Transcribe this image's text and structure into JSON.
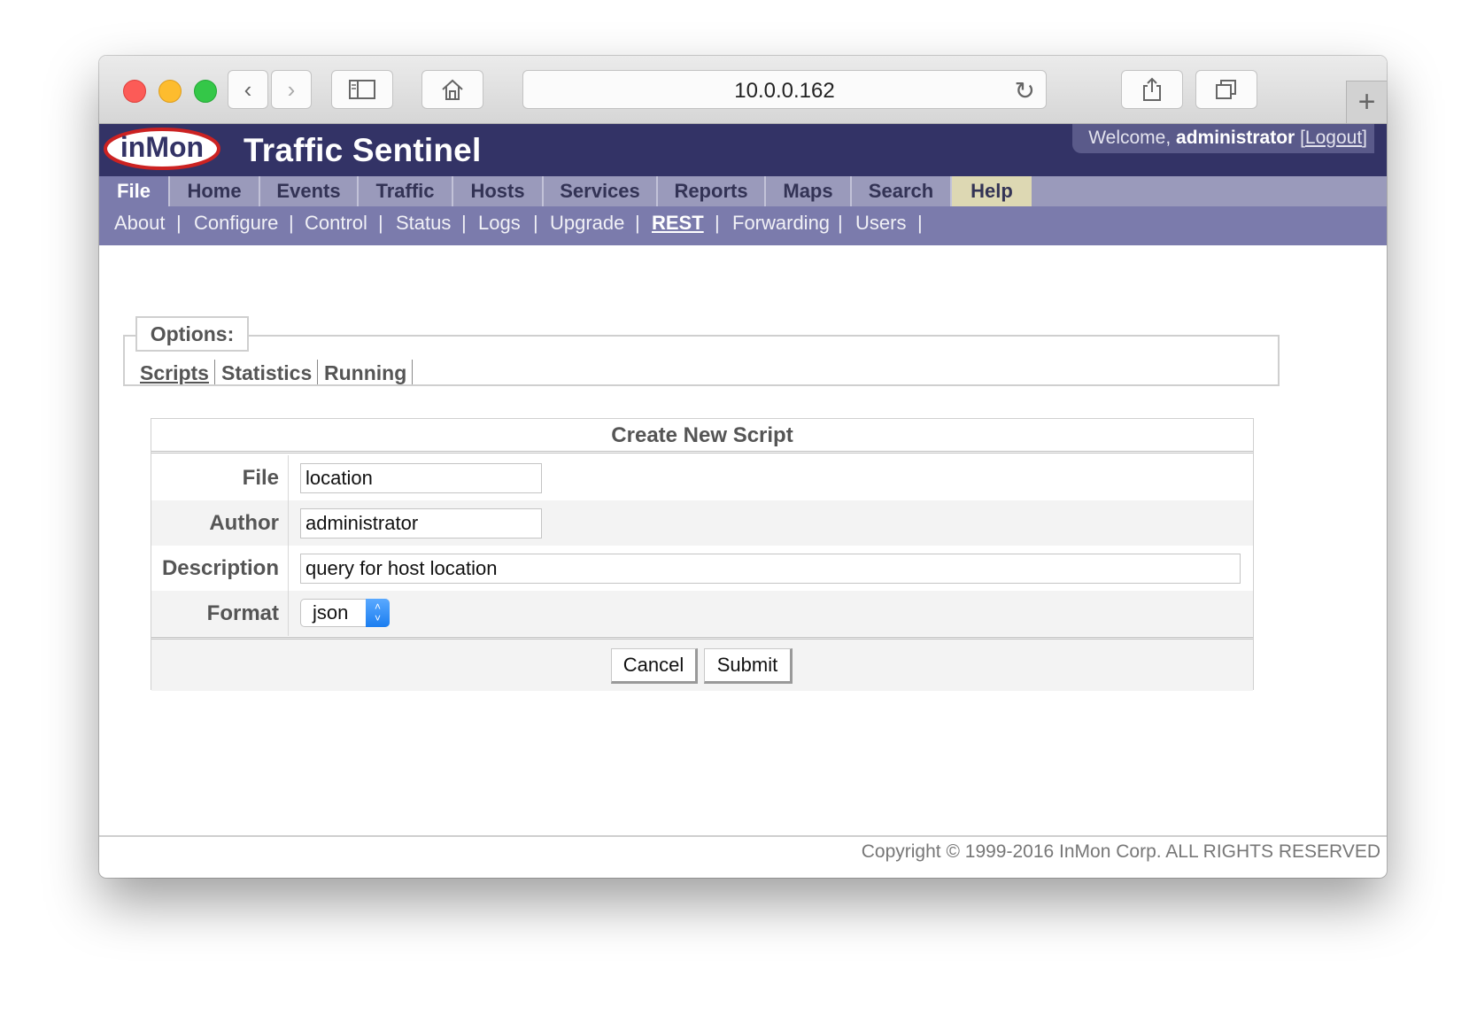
{
  "browser": {
    "url": "10.0.0.162",
    "icons": {
      "back": "chevron-left-icon",
      "forward": "chevron-right-icon",
      "sidebar": "sidebar-icon",
      "home": "home-icon",
      "reload": "reload-icon",
      "share": "share-icon",
      "tabs": "tabs-icon",
      "newtab": "plus-icon"
    }
  },
  "header": {
    "logo_text": "inMon",
    "title": "Traffic Sentinel",
    "welcome_prefix": "Welcome,",
    "user": "administrator",
    "logout": "Logout"
  },
  "nav": {
    "items": [
      "File",
      "Home",
      "Events",
      "Traffic",
      "Hosts",
      "Services",
      "Reports",
      "Maps",
      "Search",
      "Help"
    ],
    "active": "File"
  },
  "subnav": {
    "items": [
      "About",
      "Configure",
      "Control",
      "Status",
      "Logs",
      "Upgrade",
      "REST",
      "Forwarding",
      "Users"
    ],
    "current": "REST"
  },
  "options": {
    "legend": "Options:",
    "links": [
      "Scripts",
      "Statistics",
      "Running"
    ],
    "current": "Scripts"
  },
  "form": {
    "title": "Create New Script",
    "fields": {
      "file": {
        "label": "File",
        "value": "location"
      },
      "author": {
        "label": "Author",
        "value": "administrator"
      },
      "description": {
        "label": "Description",
        "value": "query for host location"
      },
      "format": {
        "label": "Format",
        "value": "json"
      }
    },
    "cancel": "Cancel",
    "submit": "Submit"
  },
  "footer": {
    "copyright": "Copyright © 1999-2016 InMon Corp. ALL RIGHTS RESERVED"
  },
  "colors": {
    "header_bg": "#333366",
    "nav_bg": "#9a9abb",
    "subnav_bg": "#7b7bac",
    "help_tab": "#ddd8b3"
  }
}
